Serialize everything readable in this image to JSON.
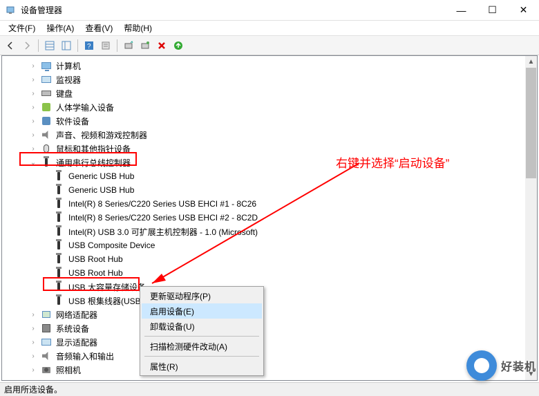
{
  "window": {
    "title": "设备管理器",
    "controls": {
      "min": "—",
      "max": "☐",
      "close": "✕"
    }
  },
  "menu": {
    "file": "文件(F)",
    "action": "操作(A)",
    "view": "查看(V)",
    "help": "帮助(H)"
  },
  "tree": {
    "n0": "计算机",
    "n1": "监视器",
    "n2": "键盘",
    "n3": "人体学输入设备",
    "n4": "软件设备",
    "n5": "声音、视频和游戏控制器",
    "n6": "鼠标和其他指针设备",
    "n7": "通用串行总线控制器",
    "c0": "Generic USB Hub",
    "c1": "Generic USB Hub",
    "c2": "Intel(R) 8 Series/C220 Series USB EHCI #1 - 8C26",
    "c3": "Intel(R) 8 Series/C220 Series USB EHCI #2 - 8C2D",
    "c4": "Intel(R) USB 3.0 可扩展主机控制器 - 1.0 (Microsoft)",
    "c5": "USB Composite Device",
    "c6": "USB Root Hub",
    "c7": "USB Root Hub",
    "c8": "USB 大容量存储设备",
    "c9": "USB 根集线器(USB",
    "n8": "网络适配器",
    "n9": "系统设备",
    "n10": "显示适配器",
    "n11": "音频输入和输出",
    "n12": "照相机"
  },
  "context": {
    "update": "更新驱动程序(P)",
    "enable": "启用设备(E)",
    "uninstall": "卸载设备(U)",
    "scan": "扫描检测硬件改动(A)",
    "props": "属性(R)"
  },
  "annotation": "右键并选择“启动设备”",
  "statusbar": "启用所选设备。",
  "watermark": "好装机"
}
